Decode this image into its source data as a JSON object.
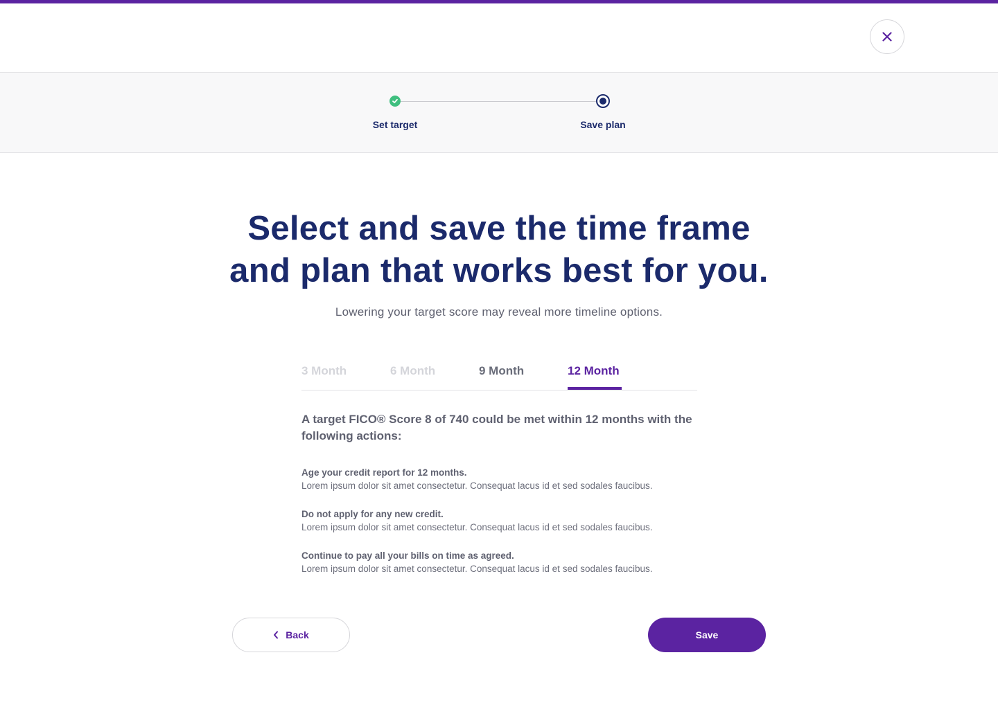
{
  "colors": {
    "brand_purple": "#5b23a1",
    "navy": "#1b2a6b",
    "success_green": "#3fbf7f",
    "muted_text": "#5f6170",
    "disabled_tab": "#d4d5da"
  },
  "header": {
    "close_icon": "close-icon"
  },
  "stepper": {
    "steps": [
      {
        "label": "Set target",
        "status": "complete",
        "icon": "check-icon"
      },
      {
        "label": "Save plan",
        "status": "current",
        "icon": "radio-current-icon"
      }
    ]
  },
  "main": {
    "headline_line1": "Select and save the time frame",
    "headline_line2": "and plan that works best for you.",
    "subheadline": "Lowering your target score may reveal more timeline options.",
    "tabs": [
      {
        "label": "3 Month",
        "state": "disabled"
      },
      {
        "label": "6 Month",
        "state": "disabled"
      },
      {
        "label": "9 Month",
        "state": "enabled"
      },
      {
        "label": "12 Month",
        "state": "selected"
      }
    ],
    "intro": "A target FICO® Score 8 of 740 could be met within 12 months with the following actions:",
    "actions": [
      {
        "title": "Age your credit report for 12 months.",
        "description": "Lorem ipsum dolor sit amet consectetur. Consequat lacus id et sed sodales faucibus."
      },
      {
        "title": "Do not apply for any new credit.",
        "description": "Lorem ipsum dolor sit amet consectetur. Consequat lacus id et sed sodales faucibus."
      },
      {
        "title": "Continue to pay all your bills on time as agreed.",
        "description": "Lorem ipsum dolor sit amet consectetur. Consequat lacus id et sed sodales faucibus."
      }
    ]
  },
  "footer": {
    "back_label": "Back",
    "back_icon": "chevron-left-icon",
    "save_label": "Save"
  }
}
